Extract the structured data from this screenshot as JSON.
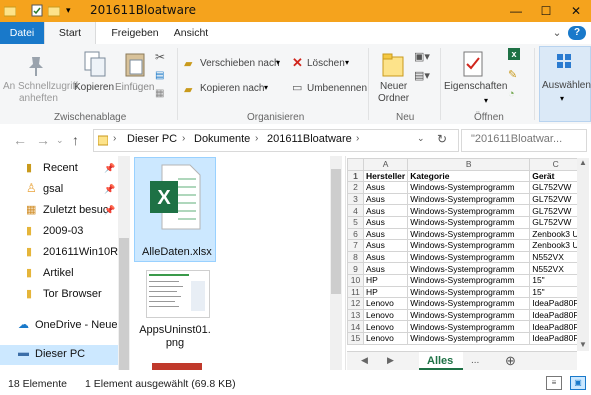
{
  "title": "201611Bloatware",
  "window_controls": {
    "minimize": "—",
    "maximize": "☐",
    "close": "✕"
  },
  "tabs": [
    "Datei",
    "Start",
    "Freigeben",
    "Ansicht"
  ],
  "ribbon": {
    "pin_label_1": "An Schnellzugriff",
    "pin_label_2": "anheften",
    "copy": "Kopieren",
    "paste": "Einfügen",
    "group_clipboard": "Zwischenablage",
    "move_to": "Verschieben nach",
    "copy_to": "Kopieren nach",
    "delete": "Löschen",
    "rename": "Umbenennen",
    "group_organize": "Organisieren",
    "new_folder_1": "Neuer",
    "new_folder_2": "Ordner",
    "group_new": "Neu",
    "properties": "Eigenschaften",
    "group_open": "Öffnen",
    "select": "Auswählen"
  },
  "address": {
    "crumbs": [
      "Dieser PC",
      "Dokumente",
      "201611Bloatware"
    ],
    "search_placeholder": "\"201611Bloatwar..."
  },
  "nav": {
    "items": [
      {
        "label": "Recent",
        "pinned": true
      },
      {
        "label": "gsal",
        "pinned": true
      },
      {
        "label": "Zuletzt besuc",
        "pinned": true
      },
      {
        "label": "2009-03",
        "pinned": false
      },
      {
        "label": "201611Win10Re",
        "pinned": false
      },
      {
        "label": "Artikel",
        "pinned": false
      },
      {
        "label": "Tor Browser",
        "pinned": false
      },
      {
        "label": "OneDrive - Neue",
        "pinned": false
      },
      {
        "label": "Dieser PC",
        "pinned": false
      }
    ]
  },
  "files": [
    {
      "name": "AlleDaten.xlsx",
      "selected": true
    },
    {
      "name": "AppsUninst01.png",
      "selected": false
    }
  ],
  "preview": {
    "col_letters": [
      "A",
      "B",
      "C"
    ],
    "headers": [
      "Hersteller",
      "Kategorie",
      "Gerät"
    ],
    "rows": [
      [
        "Asus",
        "Windows-Systemprogramm",
        "GL752VW"
      ],
      [
        "Asus",
        "Windows-Systemprogramm",
        "GL752VW"
      ],
      [
        "Asus",
        "Windows-Systemprogramm",
        "GL752VW"
      ],
      [
        "Asus",
        "Windows-Systemprogramm",
        "GL752VW"
      ],
      [
        "Asus",
        "Windows-Systemprogramm",
        "Zenbook3 U"
      ],
      [
        "Asus",
        "Windows-Systemprogramm",
        "Zenbook3 U"
      ],
      [
        "Asus",
        "Windows-Systemprogramm",
        "N552VX"
      ],
      [
        "Asus",
        "Windows-Systemprogramm",
        "N552VX"
      ],
      [
        "HP",
        "Windows-Systemprogramm",
        "15\""
      ],
      [
        "HP",
        "Windows-Systemprogramm",
        "15\""
      ],
      [
        "Lenovo",
        "Windows-Systemprogramm",
        "IdeaPad80F"
      ],
      [
        "Lenovo",
        "Windows-Systemprogramm",
        "IdeaPad80F"
      ],
      [
        "Lenovo",
        "Windows-Systemprogramm",
        "IdeaPad80F"
      ],
      [
        "Lenovo",
        "Windows-Systemprogramm",
        "IdeaPad80F"
      ]
    ],
    "sheet_tab": "Alles",
    "sheet_more": "..."
  },
  "status": {
    "count": "18 Elemente",
    "selection": "1 Element ausgewählt (69.8 KB)"
  },
  "colors": {
    "title_bar": "#f5a31d",
    "file_tab": "#1979ca",
    "selection": "#cce8ff",
    "excel_green": "#1e7145"
  }
}
